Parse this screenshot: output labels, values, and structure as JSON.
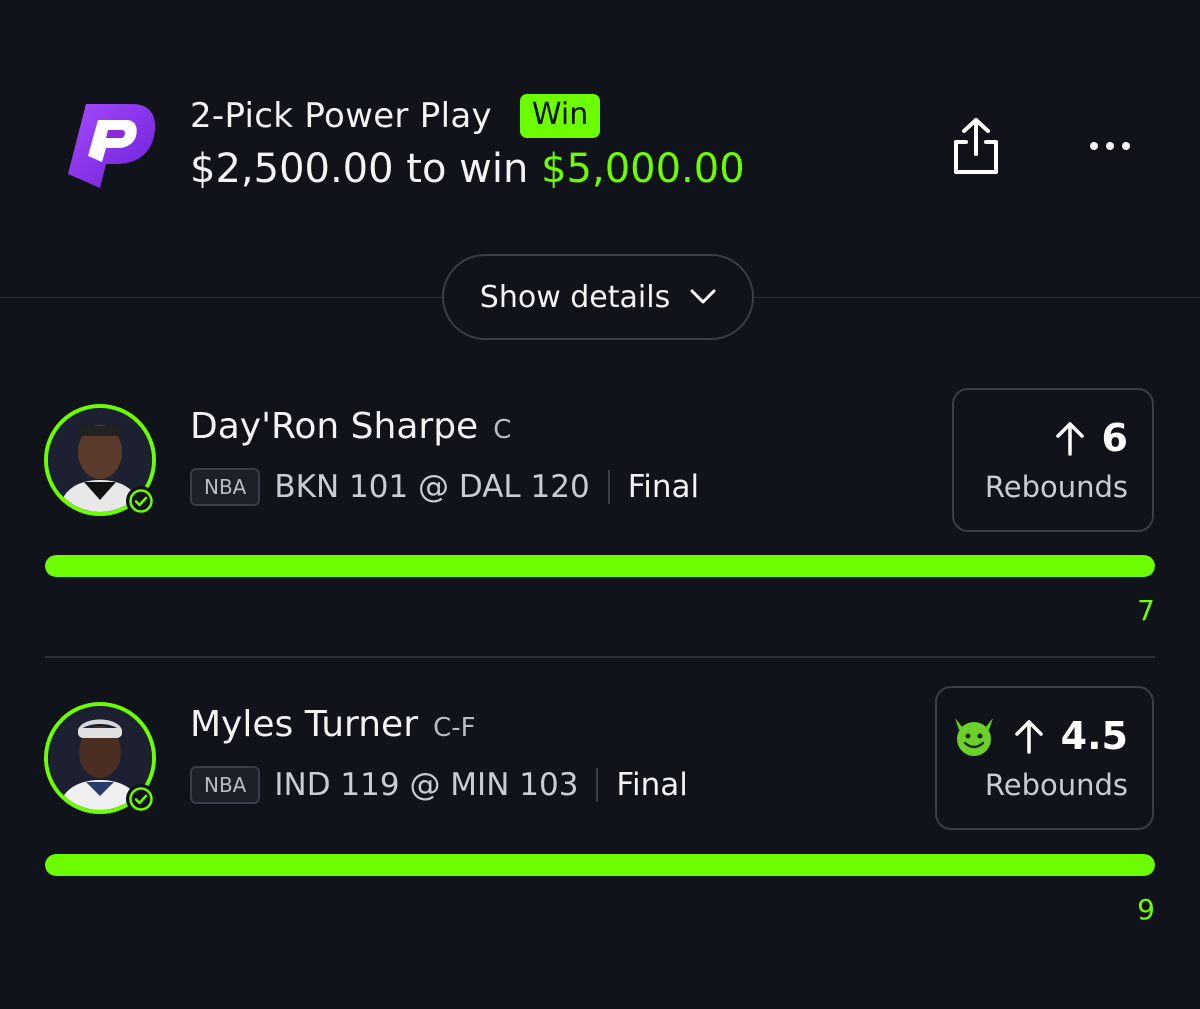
{
  "header": {
    "title": "2-Pick Power Play",
    "badge": "Win",
    "stake": "$2,500.00",
    "to_win_text": "to win",
    "payout": "$5,000.00"
  },
  "icons": {
    "logo": "prizepicks-logo",
    "share": "share-icon",
    "more": "more-icon",
    "chevron": "chevron-down-icon"
  },
  "show_details_label": "Show details",
  "colors": {
    "background": "#11131b",
    "accent_green": "#6bfd00",
    "logo_purple": "#8a2be2"
  },
  "picks": [
    {
      "name": "Day'Ron Sharpe",
      "position": "C",
      "league": "NBA",
      "game": "BKN 101 @ DAL 120",
      "status": "Final",
      "direction_icon": "arrow-up-icon",
      "line": "6",
      "stat": "Rebounds",
      "actual": "7",
      "progress_fraction": 1.0,
      "demon": false
    },
    {
      "name": "Myles Turner",
      "position": "C-F",
      "league": "NBA",
      "game": "IND 119 @ MIN 103",
      "status": "Final",
      "direction_icon": "arrow-up-icon",
      "line": "4.5",
      "stat": "Rebounds",
      "actual": "9",
      "progress_fraction": 1.0,
      "demon": true
    }
  ]
}
